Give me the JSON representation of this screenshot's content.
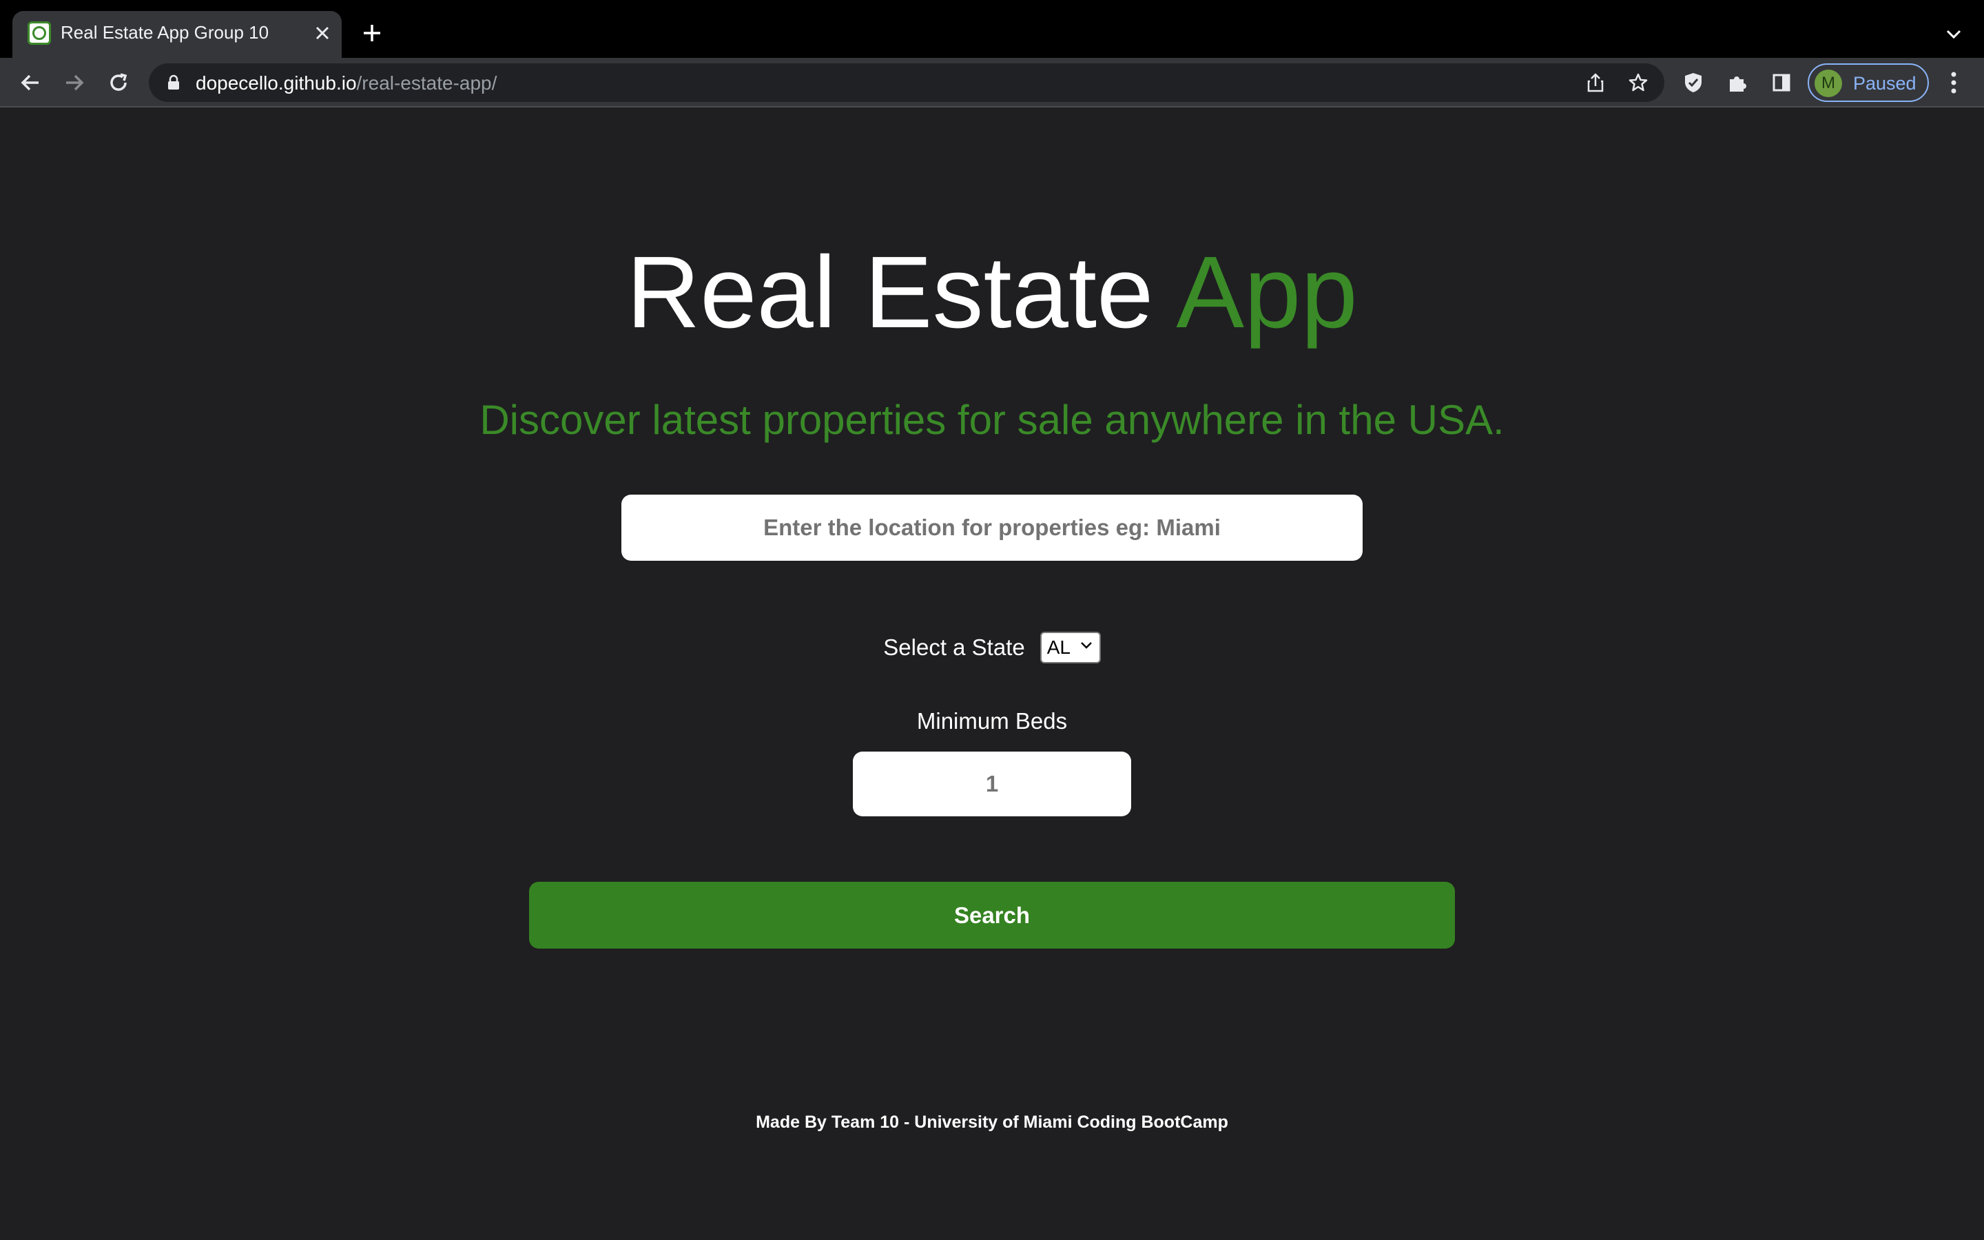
{
  "browser": {
    "tab_title": "Real Estate App Group 10",
    "url_host": "dopecello.github.io",
    "url_path": "/real-estate-app/",
    "profile_initial": "M",
    "profile_status": "Paused",
    "icons": [
      "tab-favicon",
      "close-icon",
      "plus-icon",
      "chevron-down-icon",
      "back-arrow-icon",
      "forward-arrow-icon",
      "reload-icon",
      "lock-icon",
      "share-icon",
      "star-icon",
      "shield-icon",
      "puzzle-icon",
      "side-panel-icon",
      "kebab-menu-icon"
    ]
  },
  "page": {
    "title_main": "Real Estate ",
    "title_accent": "App",
    "subtitle": "Discover latest properties for sale anywhere in the USA.",
    "location_placeholder": "Enter the location for properties eg: Miami",
    "state_label": "Select a State",
    "state_selected": "AL",
    "beds_label": "Minimum Beds",
    "beds_value": "1",
    "search_label": "Search",
    "footer": "Made By Team 10 - University of Miami Coding BootCamp"
  },
  "colors": {
    "background": "#1f1f21",
    "accent_green": "#3a8a28",
    "button_green": "#358222"
  }
}
